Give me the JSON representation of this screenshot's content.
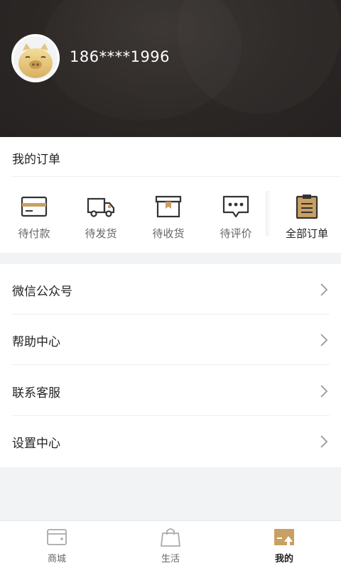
{
  "profile": {
    "username": "186****1996",
    "avatar_icon": "pig-avatar-icon"
  },
  "orders": {
    "title": "我的订单",
    "items": [
      {
        "label": "待付款",
        "icon": "wallet-card-icon"
      },
      {
        "label": "待发货",
        "icon": "delivery-truck-icon"
      },
      {
        "label": "待收货",
        "icon": "package-box-icon"
      },
      {
        "label": "待评价",
        "icon": "comment-bubble-icon"
      },
      {
        "label": "全部订单",
        "icon": "clipboard-list-icon"
      }
    ]
  },
  "menu": {
    "items": [
      {
        "label": "微信公众号"
      },
      {
        "label": "帮助中心"
      },
      {
        "label": "联系客服"
      },
      {
        "label": "设置中心"
      }
    ]
  },
  "tabbar": {
    "items": [
      {
        "label": "商城",
        "icon": "wallet-icon",
        "active": false
      },
      {
        "label": "生活",
        "icon": "shopping-bag-icon",
        "active": false
      },
      {
        "label": "我的",
        "icon": "profile-card-icon",
        "active": true
      }
    ]
  },
  "colors": {
    "header_bg": "#2b2725",
    "accent_gold": "#c9a063",
    "icon_dark": "#333333",
    "text_primary": "#222222",
    "text_secondary": "#666666"
  }
}
